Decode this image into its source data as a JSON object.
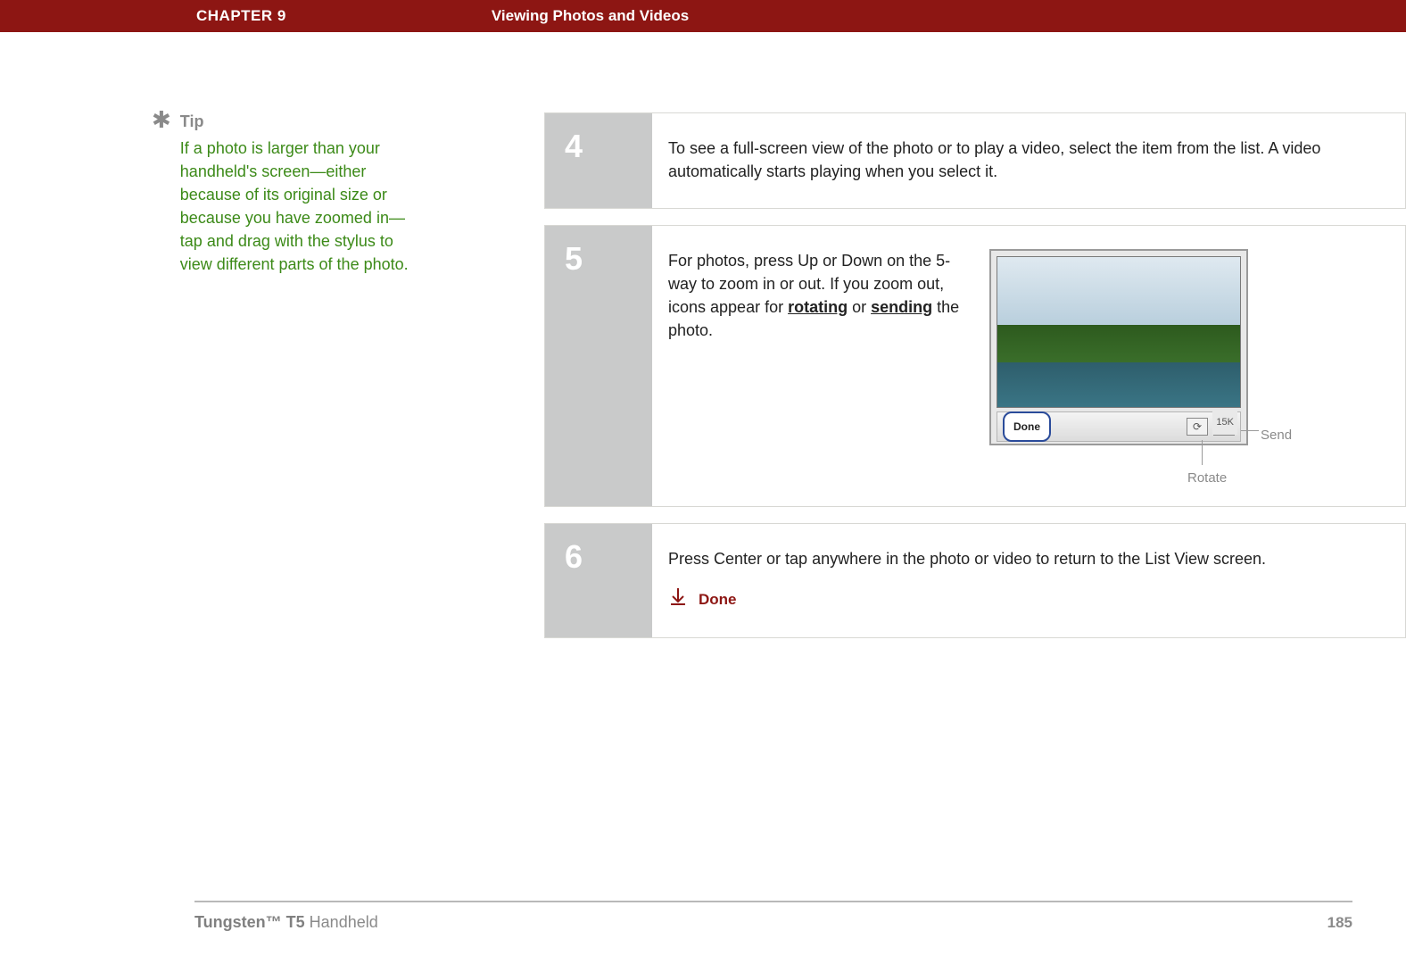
{
  "header": {
    "chapter": "CHAPTER 9",
    "title": "Viewing Photos and Videos"
  },
  "tip": {
    "label": "Tip",
    "body": "If a photo is larger than your handheld's screen—either because of its original size or because you have zoomed in—tap and drag with the stylus to view different parts of the photo."
  },
  "steps": {
    "s4": {
      "num": "4",
      "text": "To see a full-screen view of the photo or to play a video, select the item from the list. A video automatically starts playing when you select it."
    },
    "s5": {
      "num": "5",
      "text_before": "For photos, press Up or Down on the 5-way to zoom in or out. If you zoom out, icons appear for ",
      "link1": "rotating",
      "mid": " or ",
      "link2": "sending",
      "text_after": " the photo.",
      "device": {
        "done_button": "Done",
        "size": "15K",
        "callout_send": "Send",
        "callout_rotate": "Rotate"
      }
    },
    "s6": {
      "num": "6",
      "text": "Press Center or tap anywhere in the photo or video to return to the List View screen.",
      "done": "Done"
    }
  },
  "footer": {
    "product_bold": "Tungsten™ T5",
    "product_rest": " Handheld",
    "page": "185"
  }
}
